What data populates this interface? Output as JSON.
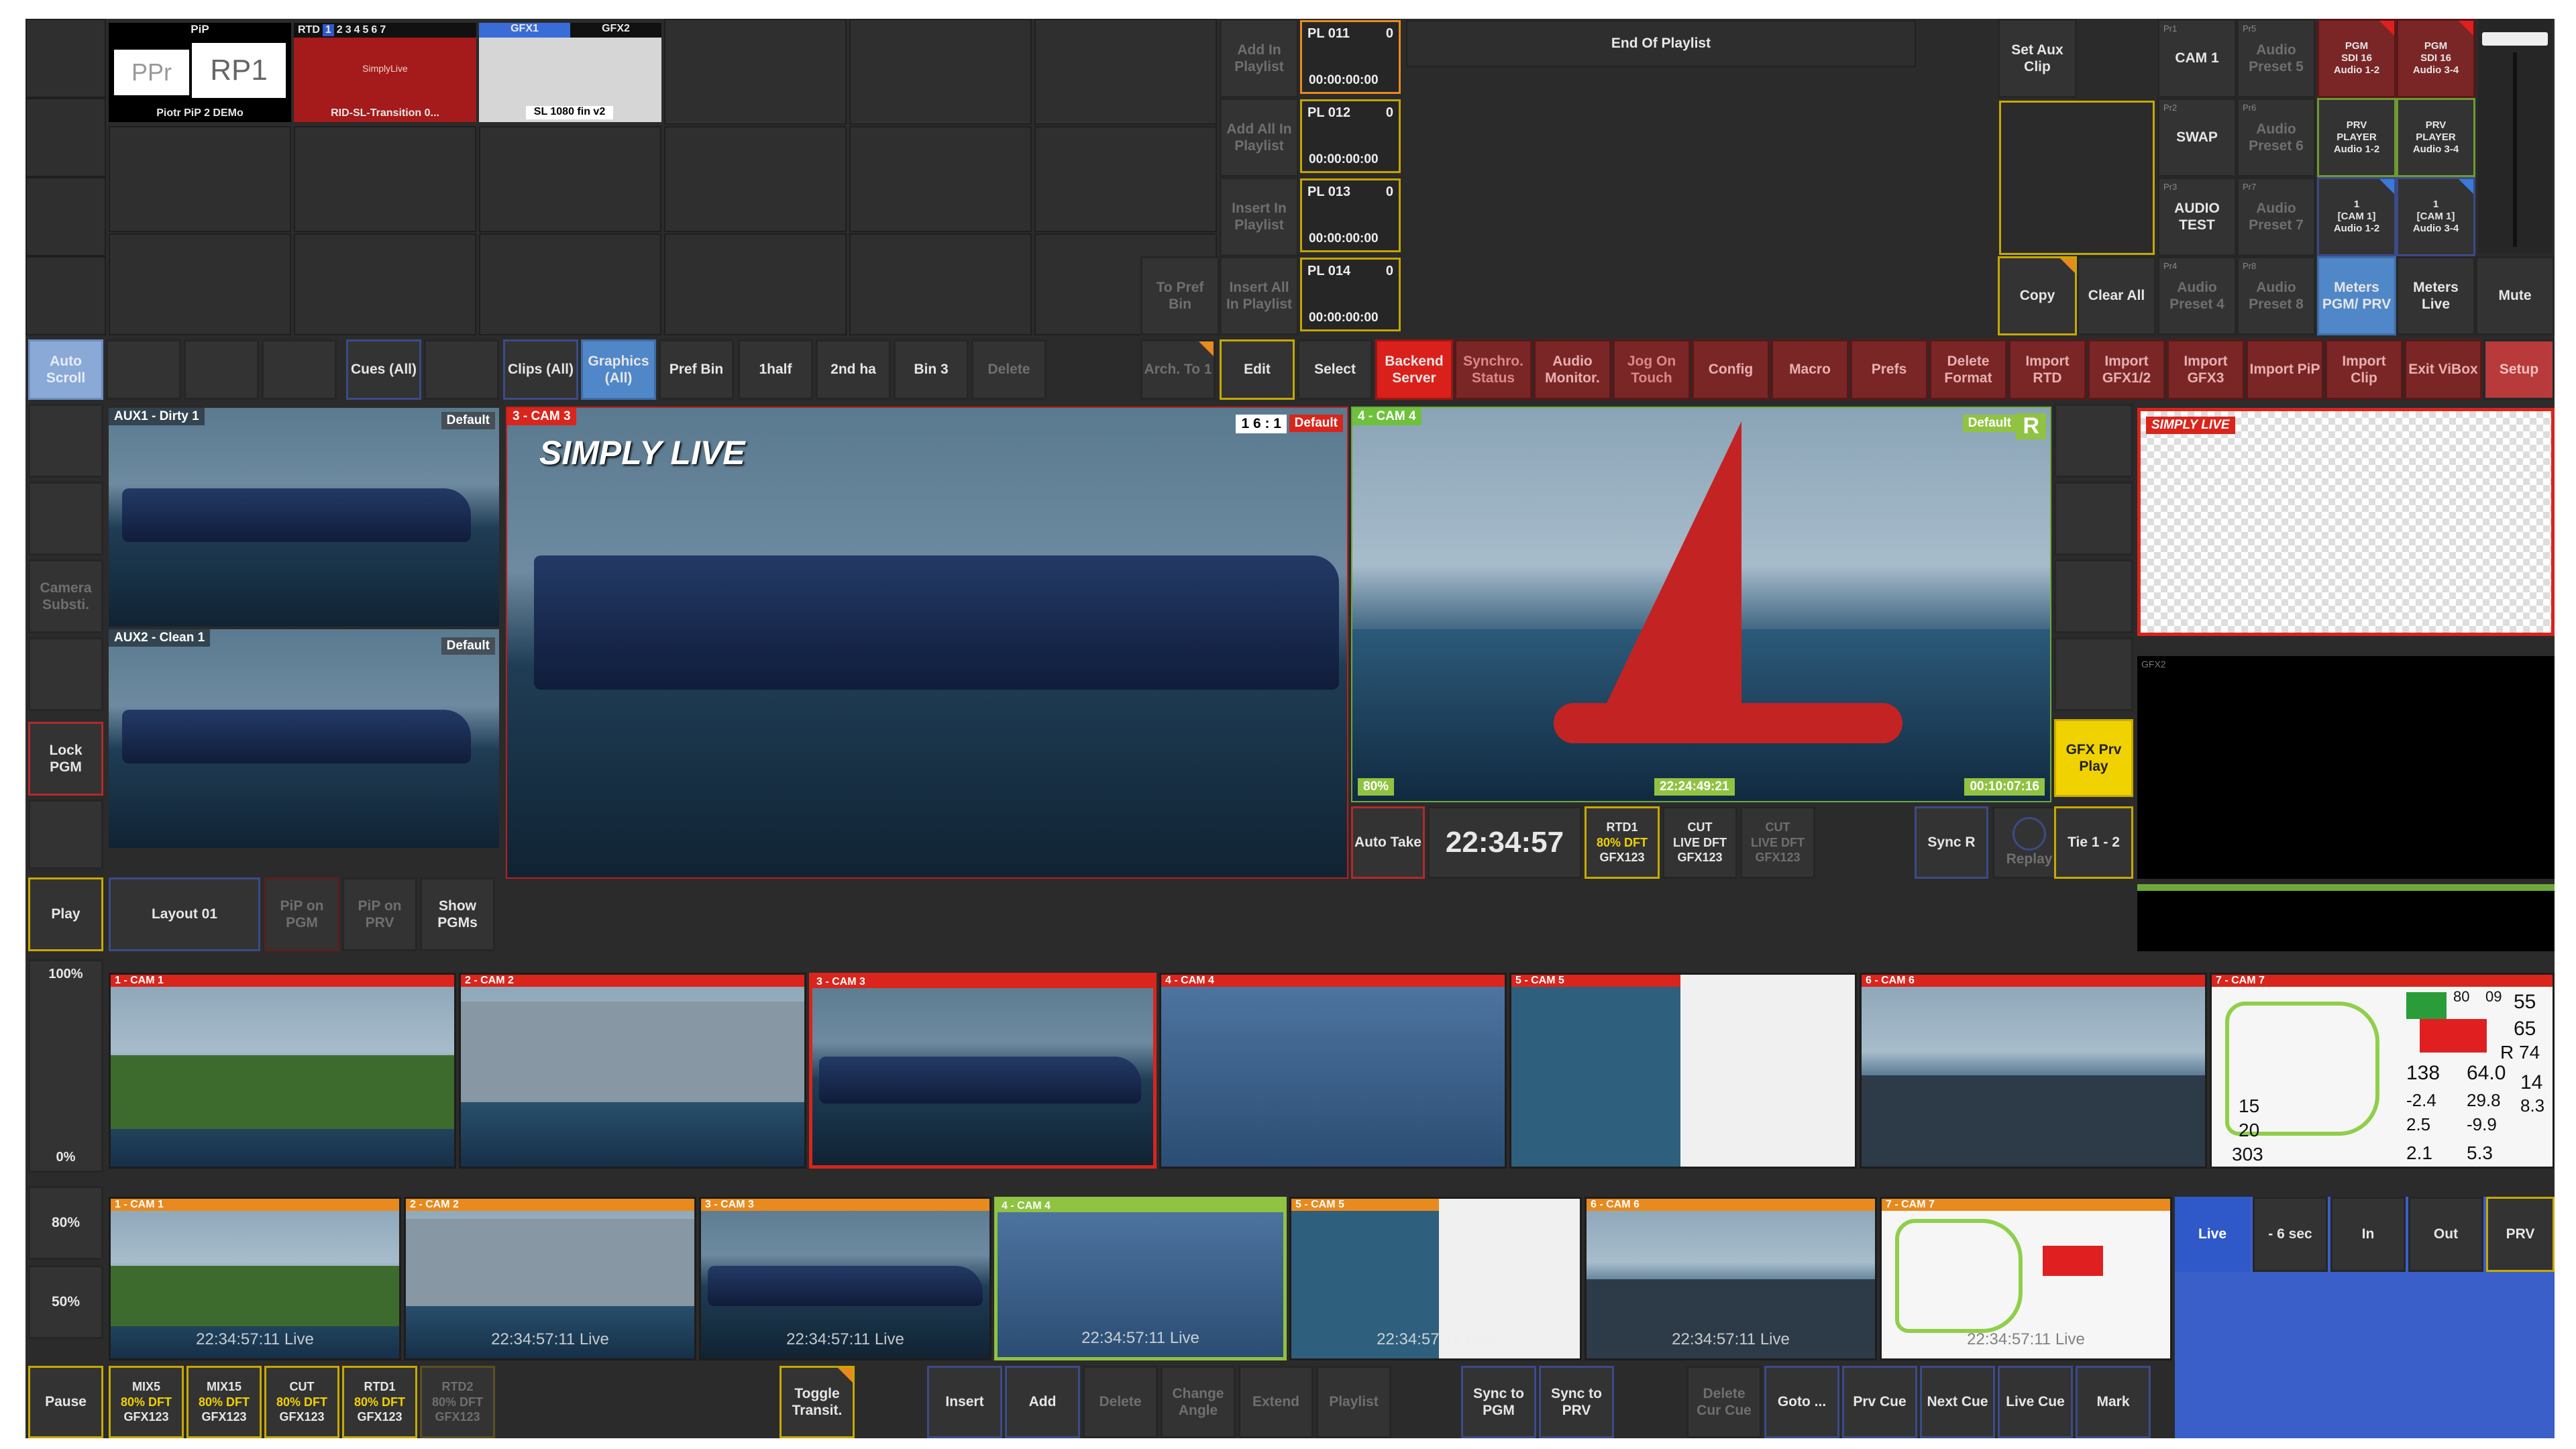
{
  "top_grid": {
    "pip": {
      "title": "PiP",
      "left": "PPr",
      "right": "RP1",
      "caption": "Piotr PiP 2 DEMo"
    },
    "rtd": {
      "title": "RTD",
      "nums": [
        "1",
        "2",
        "3",
        "4",
        "5",
        "6",
        "7"
      ],
      "logo": "SimplyLive",
      "caption": "RID-SL-Transition 0..."
    },
    "gfx": {
      "tab1": "GFX1",
      "tab2": "GFX2",
      "caption": "SL 1080 fin v2"
    }
  },
  "playlist_actions": [
    "Add In Playlist",
    "Add All In Playlist",
    "Insert In Playlist",
    "Insert All In Playlist"
  ],
  "to_pref_bin": "To Pref Bin",
  "playlist_items": [
    {
      "name": "PL 011",
      "count": "0",
      "time": "00:00:00:00"
    },
    {
      "name": "PL 012",
      "count": "0",
      "time": "00:00:00:00"
    },
    {
      "name": "PL 013",
      "count": "0",
      "time": "00:00:00:00"
    },
    {
      "name": "PL 014",
      "count": "0",
      "time": "00:00:00:00"
    }
  ],
  "end_of_playlist": "End Of Playlist",
  "set_aux_clip": "Set Aux Clip",
  "copy": "Copy",
  "clear_all": "Clear All",
  "presets": [
    {
      "tag": "Pr1",
      "label": "CAM 1"
    },
    {
      "tag": "Pr5",
      "label": "Audio Preset 5"
    },
    {
      "tag": "Pr2",
      "label": "SWAP"
    },
    {
      "tag": "Pr6",
      "label": "Audio Preset 6"
    },
    {
      "tag": "Pr3",
      "label": "AUDIO TEST"
    },
    {
      "tag": "Pr7",
      "label": "Audio Preset 7"
    },
    {
      "tag": "Pr4",
      "label": "Audio Preset 4"
    },
    {
      "tag": "Pr8",
      "label": "Audio Preset 8"
    }
  ],
  "audio_routes": [
    {
      "l1": "PGM",
      "l2": "SDI 16",
      "l3": "Audio 1-2"
    },
    {
      "l1": "PGM",
      "l2": "SDI 16",
      "l3": "Audio 3-4"
    },
    {
      "l1": "PRV",
      "l2": "PLAYER",
      "l3": "Audio 1-2"
    },
    {
      "l1": "PRV",
      "l2": "PLAYER",
      "l3": "Audio 3-4"
    },
    {
      "l1": "1",
      "l2": "[CAM 1]",
      "l3": "Audio 1-2"
    },
    {
      "l1": "1",
      "l2": "[CAM 1]",
      "l3": "Audio 3-4"
    }
  ],
  "meters_pgm": "Meters PGM/ PRV",
  "meters_live": "Meters Live",
  "mute": "Mute",
  "toolbar": {
    "auto_scroll": "Auto Scroll",
    "cues": "Cues (All)",
    "clips": "Clips (All)",
    "graphics": "Graphics (All)",
    "pref_bin": "Pref Bin",
    "half1": "1half",
    "half2": "2nd ha",
    "bin3": "Bin 3",
    "delete": "Delete",
    "arch": "Arch. To 1",
    "edit": "Edit",
    "select": "Select",
    "backend": "Backend Server",
    "synchro": "Synchro. Status",
    "audio_mon": "Audio Monitor.",
    "jog": "Jog On Touch",
    "config": "Config",
    "macro": "Macro",
    "prefs": "Prefs",
    "delete_format": "Delete Format",
    "import_rtd": "Import RTD",
    "import_gfx12": "Import GFX1/2",
    "import_gfx3": "Import GFX3",
    "import_pip": "Import PiP",
    "import_clip": "Import Clip",
    "exit_vibox": "Exit ViBox",
    "setup": "Setup"
  },
  "left_col": {
    "camera_subst": "Camera Substi.",
    "lock_pgm": "Lock PGM",
    "play": "Play",
    "pct_100": "100%",
    "pct_0": "0%",
    "pct_80": "80%",
    "pct_50": "50%",
    "pause": "Pause"
  },
  "aux": {
    "aux1": "AUX1 - Dirty 1",
    "aux2": "AUX2 - Clean 1",
    "default": "Default"
  },
  "pgm": {
    "label": "3 - CAM 3",
    "ratio": "1 6 : 1",
    "default": "Default",
    "logo": "SIMPLY LIVE"
  },
  "prv": {
    "label": "4 - CAM 4",
    "default": "Default",
    "r": "R",
    "pct": "80%",
    "tc1": "22:24:49:21",
    "tc2": "00:10:07:16"
  },
  "gfx_prv": {
    "logo": "SIMPLY LIVE",
    "label2": "GFX2"
  },
  "controls": {
    "auto_take": "Auto Take",
    "clock": "22:34:57",
    "rtd1": {
      "t": "RTD1",
      "p": "80% DFT",
      "g": "GFX123"
    },
    "cut_live": {
      "t": "CUT",
      "p": "LIVE DFT",
      "g": "GFX123"
    },
    "cut_live2": {
      "t": "CUT",
      "p": "LIVE DFT",
      "g": "GFX123"
    },
    "sync_r": "Sync R",
    "replay": "Replay",
    "gfx_prv_play": "GFX Prv Play",
    "tie": "Tie 1 - 2"
  },
  "layout": {
    "layout": "Layout 01",
    "pip_pgm": "PiP on PGM",
    "pip_prv": "PiP on PRV",
    "show_pgms": "Show PGMs"
  },
  "cams_row1": [
    "1 - CAM 1",
    "2 - CAM 2",
    "3 - CAM 3",
    "4 - CAM 4",
    "5 - CAM 5",
    "6 - CAM 6",
    "7 - CAM 7"
  ],
  "cams_row2": [
    "1 - CAM 1",
    "2 - CAM 2",
    "3 - CAM 3",
    "4 - CAM 4",
    "5 - CAM 5",
    "6 - CAM 6",
    "7 - CAM 7"
  ],
  "cam_stamp": "22:34:57:11",
  "cam_live": "Live",
  "cam7_stats": {
    "a": "80",
    "b": "09",
    "c": "55",
    "d": "65",
    "e": "R 74",
    "f": "138",
    "g": "64.0",
    "h": "14",
    "i": "-2.4",
    "j": "29.8",
    "k": "8.3",
    "l": "2.5",
    "m": "-9.9",
    "n": "2.1",
    "o": "5.3",
    "p": "15",
    "q": "20",
    "r": "303"
  },
  "right_ctrl": {
    "live": "Live",
    "minus6": "- 6 sec",
    "in": "In",
    "out": "Out",
    "prv": "PRV"
  },
  "bottom": {
    "mix5": {
      "t": "MIX5",
      "p": "80% DFT",
      "g": "GFX123"
    },
    "mix15": {
      "t": "MIX15",
      "p": "80% DFT",
      "g": "GFX123"
    },
    "cut": {
      "t": "CUT",
      "p": "80% DFT",
      "g": "GFX123"
    },
    "rtd1": {
      "t": "RTD1",
      "p": "80% DFT",
      "g": "GFX123"
    },
    "rtd2": {
      "t": "RTD2",
      "p": "80% DFT",
      "g": "GFX123"
    },
    "toggle": "Toggle Transit.",
    "insert": "Insert",
    "add": "Add",
    "delete": "Delete",
    "change_angle": "Change Angle",
    "extend": "Extend",
    "playlist": "Playlist",
    "sync_pgm": "Sync to PGM",
    "sync_prv": "Sync to PRV",
    "delete_cur_cue": "Delete Cur Cue",
    "goto": "Goto ...",
    "prv_cue": "Prv Cue",
    "next_cue": "Next Cue",
    "live_cue": "Live Cue",
    "mark": "Mark"
  }
}
